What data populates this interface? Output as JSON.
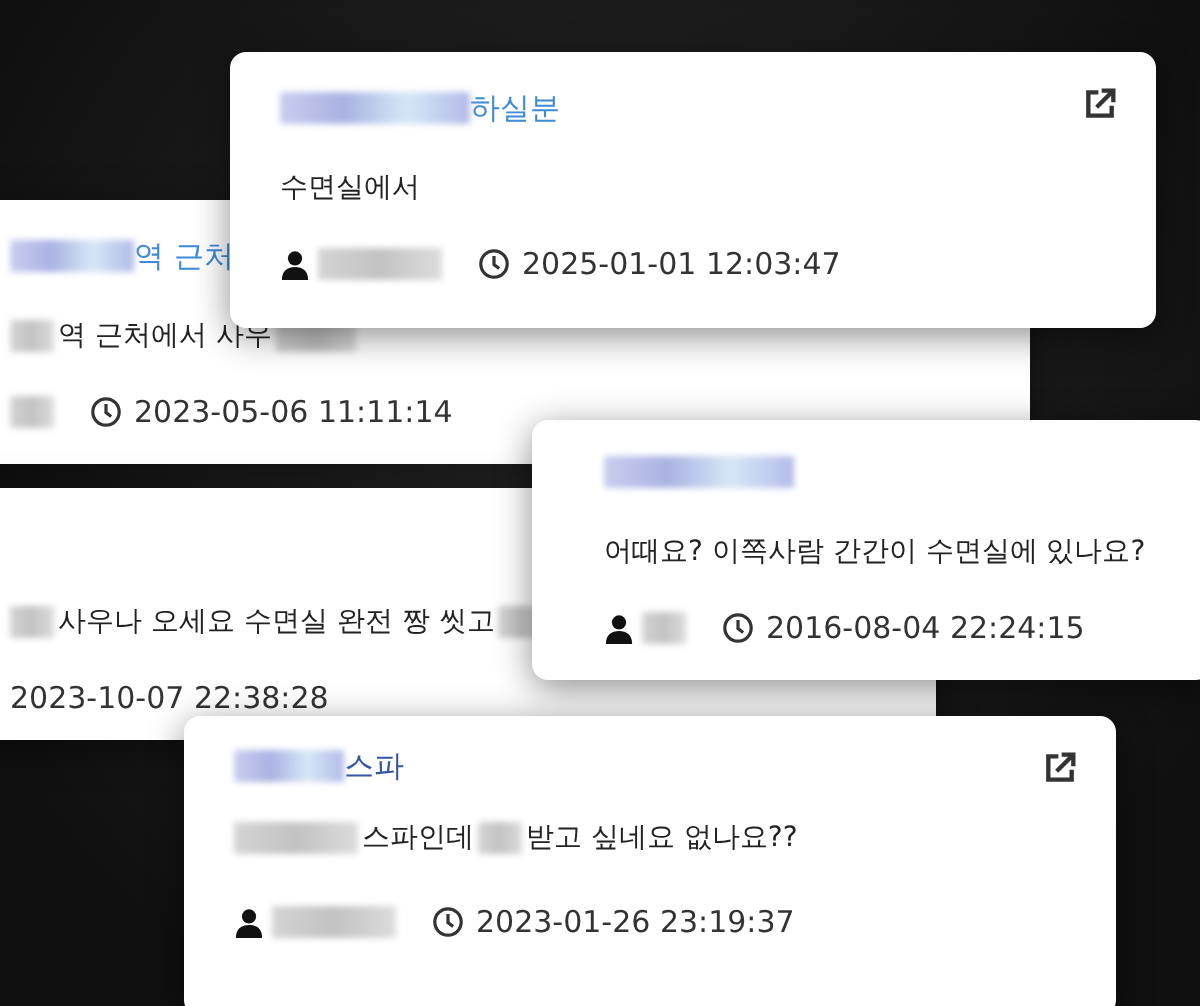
{
  "cards": [
    {
      "title": [
        {
          "kind": "blur"
        },
        {
          "kind": "text",
          "text": "역 근처"
        }
      ],
      "body": [
        {
          "kind": "blur_s"
        },
        {
          "kind": "text",
          "text": "역 근처에서 사우"
        },
        {
          "kind": "blur_l"
        }
      ],
      "meta": [
        {
          "kind": "blur_s"
        },
        {
          "kind": "time",
          "text": "2023-05-06 11:11:14"
        }
      ]
    },
    {
      "body": [
        {
          "kind": "blur_s"
        },
        {
          "kind": "text",
          "text": "사우나 오세요 수면실 완전 짱 씻고"
        },
        {
          "kind": "blur_s"
        }
      ],
      "meta": [
        {
          "kind": "text",
          "text": "2023-10-07 22:38:28"
        }
      ]
    },
    {
      "title": [
        {
          "kind": "blur"
        },
        {
          "kind": "text",
          "text": "하실분"
        }
      ],
      "external_link": true,
      "body": [
        {
          "kind": "text",
          "text": "수면실에서"
        }
      ],
      "meta": [
        {
          "kind": "user"
        },
        {
          "kind": "blur"
        },
        {
          "kind": "time",
          "text": "2025-01-01 12:03:47"
        }
      ]
    },
    {
      "title": [
        {
          "kind": "blur"
        }
      ],
      "external_link": false,
      "body": [
        {
          "kind": "text",
          "text": "어때요? 이쪽사람 간간이 수면실에 있나요?"
        }
      ],
      "meta": [
        {
          "kind": "user"
        },
        {
          "kind": "blur_s"
        },
        {
          "kind": "time",
          "text": "2016-08-04 22:24:15"
        }
      ]
    },
    {
      "title": [
        {
          "kind": "blur_s"
        },
        {
          "kind": "text",
          "text": "스파"
        }
      ],
      "external_link": true,
      "body": [
        {
          "kind": "blur"
        },
        {
          "kind": "text",
          "text": "스파인데"
        },
        {
          "kind": "blur_s"
        },
        {
          "kind": "text",
          "text": "받고 싶네요 없나요??"
        }
      ],
      "meta": [
        {
          "kind": "user"
        },
        {
          "kind": "blur"
        },
        {
          "kind": "time",
          "text": "2023-01-26 23:19:37"
        }
      ]
    }
  ]
}
